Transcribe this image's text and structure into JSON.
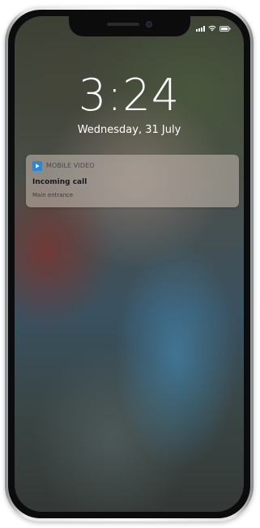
{
  "lock_screen": {
    "time": "3:24",
    "date": "Wednesday, 31 July"
  },
  "status_bar": {
    "signal_icon": "signal-bars-icon",
    "wifi_icon": "wifi-icon",
    "battery_icon": "battery-icon"
  },
  "notification": {
    "app_icon": "play-icon",
    "app_name": "MOBILE VIDEO",
    "title": "Incoming call",
    "body": "Main entrance"
  },
  "colors": {
    "app_icon_blue": "#2a86d8",
    "text_white": "#ffffff"
  }
}
